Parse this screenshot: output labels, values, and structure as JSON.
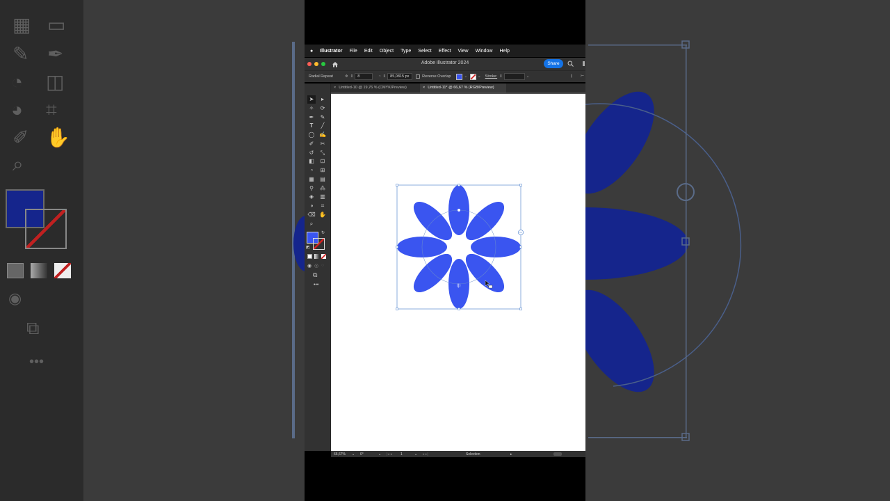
{
  "menubar": {
    "app_name": "Illustrator",
    "items": [
      "File",
      "Edit",
      "Object",
      "Type",
      "Select",
      "Effect",
      "View",
      "Window",
      "Help"
    ]
  },
  "window": {
    "title": "Adobe Illustrator 2024",
    "share_label": "Share"
  },
  "control_bar": {
    "mode_label": "Radial Repeat",
    "instances_value": "8",
    "radius_value": "85,0815 px",
    "reverse_overlap_label": "Reverse Overlap",
    "stroke_label": "Stroke:"
  },
  "tabs": [
    {
      "label": "Untitled-10 @ 19,76 % (CMYK/Preview)",
      "active": false
    },
    {
      "label": "Untitled-11* @ 66,67 % (RGB/Preview)",
      "active": true
    }
  ],
  "status_bar": {
    "zoom": "66,67%",
    "rotation": "0°",
    "artboard": "1",
    "tool_label": "Selection"
  },
  "colors": {
    "fill": "#3a55f0",
    "bg_fill_dark": "#15258c",
    "selection": "#5a8ad0",
    "share": "#1473e6"
  },
  "icons": {
    "apple": "apple-icon",
    "home": "home-icon",
    "search": "search-icon",
    "overflow": "more-icon"
  }
}
